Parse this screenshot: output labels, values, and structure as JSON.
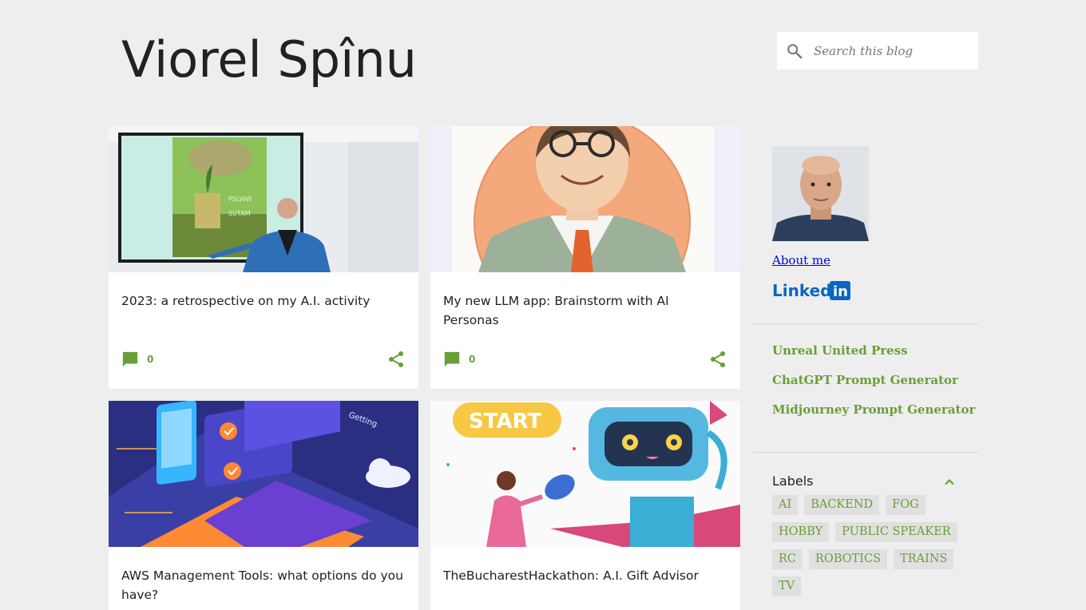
{
  "blog": {
    "title": "Viorel Spînu"
  },
  "search": {
    "placeholder": "Search this blog",
    "icon": "search-icon"
  },
  "posts": [
    {
      "title": "2023: a retrospective on my A.I. activity",
      "comments": "0"
    },
    {
      "title": "My new LLM app: Brainstorm with AI Personas",
      "comments": "0"
    },
    {
      "title": "AWS Management Tools: what options do you have?"
    },
    {
      "title": "TheBucharestHackathon: A.I. Gift Advisor"
    }
  ],
  "thumb_text": {
    "slide_line1": "PSLWW",
    "slide_line2": "SUTAM",
    "getting": "Getting",
    "start": "START"
  },
  "sidebar": {
    "about_label": "About me",
    "linkedin_label": "Linked",
    "linkedin_in": "in",
    "links": [
      "Unreal United Press",
      "ChatGPT Prompt Generator",
      "Midjourney Prompt Generator"
    ],
    "labels_title": "Labels",
    "labels": [
      "AI",
      "BACKEND",
      "FOG",
      "HOBBY",
      "PUBLIC SPEAKER",
      "RC",
      "ROBOTICS",
      "TRAINS",
      "TV"
    ]
  },
  "colors": {
    "accent": "#689f38",
    "background": "#eeeeee",
    "title": "#212121"
  }
}
